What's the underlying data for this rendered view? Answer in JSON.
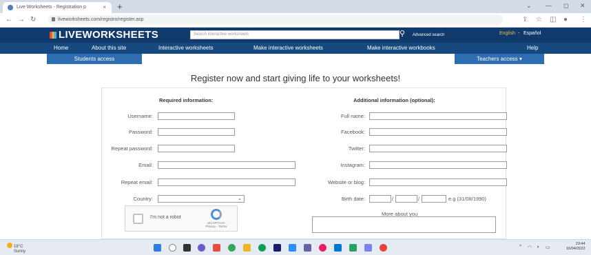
{
  "browser": {
    "tab_title": "Live Worksheets - Registration p",
    "tab_close": "×",
    "new_tab": "+",
    "url": "liveworksheets.com/registro/register.asp"
  },
  "site": {
    "logo": "LIVEWORKSHEETS",
    "search_placeholder": "Search interactive worksheets",
    "advanced_search": "Advanced search",
    "lang_english": "English",
    "lang_espanol": "Español"
  },
  "nav": {
    "items": [
      "Home",
      "About this site",
      "Interactive worksheets",
      "Make interactive worksheets",
      "Make interactive workbooks",
      "Help"
    ]
  },
  "access": {
    "students": "Students access",
    "teachers": "Teachers access ▾"
  },
  "form": {
    "headline": "Register now and start giving life to your worksheets!",
    "required_title": "Required information:",
    "optional_title": "Additional information (optional):",
    "left_labels": [
      "Username:",
      "Password:",
      "Repeat password:",
      "Email:",
      "Repeat email:",
      "Country:"
    ],
    "right_labels": [
      "Full name:",
      "Facebook:",
      "Twitter:",
      "Instagram:",
      "Website or blog:",
      "Birth date:"
    ],
    "date_hint": "e.g (31/08/1990)",
    "date_sep": "/",
    "captcha_label": "I'm not a robot",
    "captcha_brand": "reCAPTCHA",
    "captcha_links": "Privacy - Terms",
    "more_about": "More about you"
  },
  "taskbar": {
    "weather_temp": "18°C",
    "weather_desc": "Sunny",
    "time": "23:44",
    "date": "16/04/2022"
  },
  "colors": {
    "header": "#0f3a6b",
    "nav": "#16497f",
    "access_tab": "#2f6db3"
  }
}
